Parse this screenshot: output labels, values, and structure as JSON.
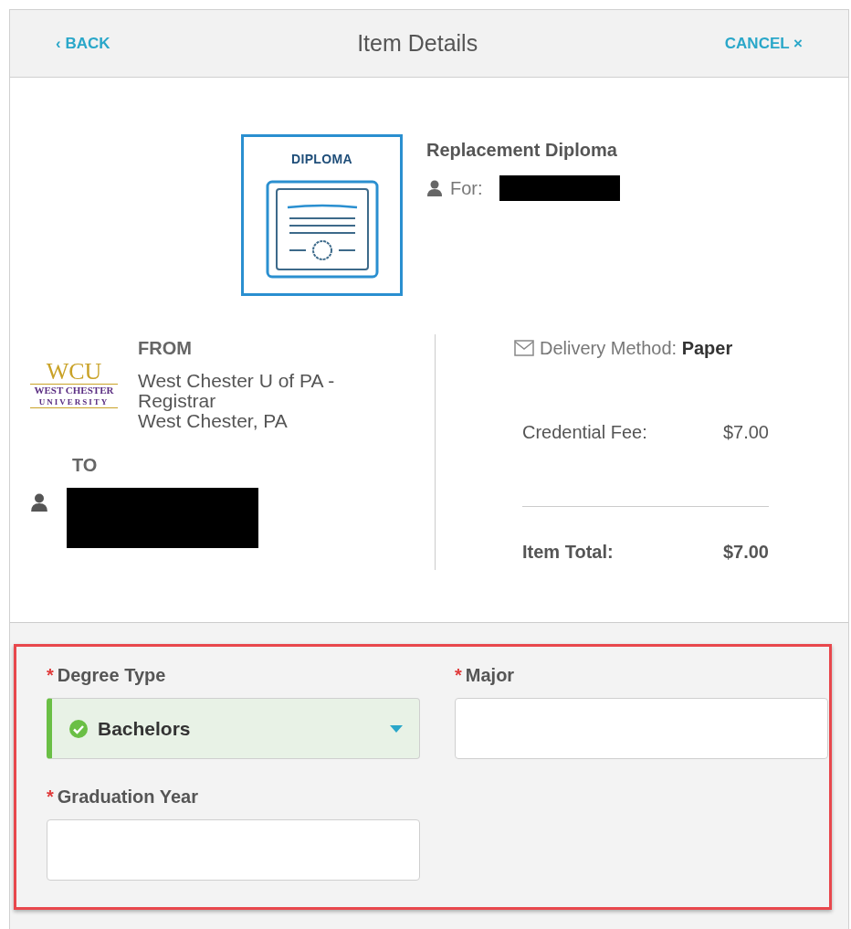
{
  "header": {
    "back": "‹ BACK",
    "title": "Item Details",
    "cancel": "CANCEL ×"
  },
  "item": {
    "badge": "DIPLOMA",
    "name": "Replacement Diploma",
    "for_label": "For:",
    "for_redacted": true
  },
  "from": {
    "label": "FROM",
    "logo": {
      "big": "WCU",
      "line1": "WEST CHESTER",
      "line2": "UNIVERSITY"
    },
    "lines": [
      "West Chester U of PA -",
      "Registrar",
      "West Chester, PA"
    ]
  },
  "to": {
    "label": "TO",
    "redacted": true
  },
  "delivery": {
    "label": "Delivery Method:",
    "value": "Paper"
  },
  "fees": [
    {
      "label": "Credential Fee:",
      "amount": "$7.00",
      "kind": "fee"
    },
    {
      "label": "Item Total:",
      "amount": "$7.00",
      "kind": "total"
    }
  ],
  "form": {
    "highlighted": true,
    "fields": [
      {
        "required_mark": "*",
        "label": "Degree Type",
        "kind": "select",
        "value": "Bachelors",
        "valid": true
      },
      {
        "required_mark": "*",
        "label": "Major",
        "kind": "text",
        "valid": false
      },
      {
        "required_mark": "*",
        "label": "Graduation Year",
        "kind": "text",
        "valid": false
      }
    ]
  }
}
